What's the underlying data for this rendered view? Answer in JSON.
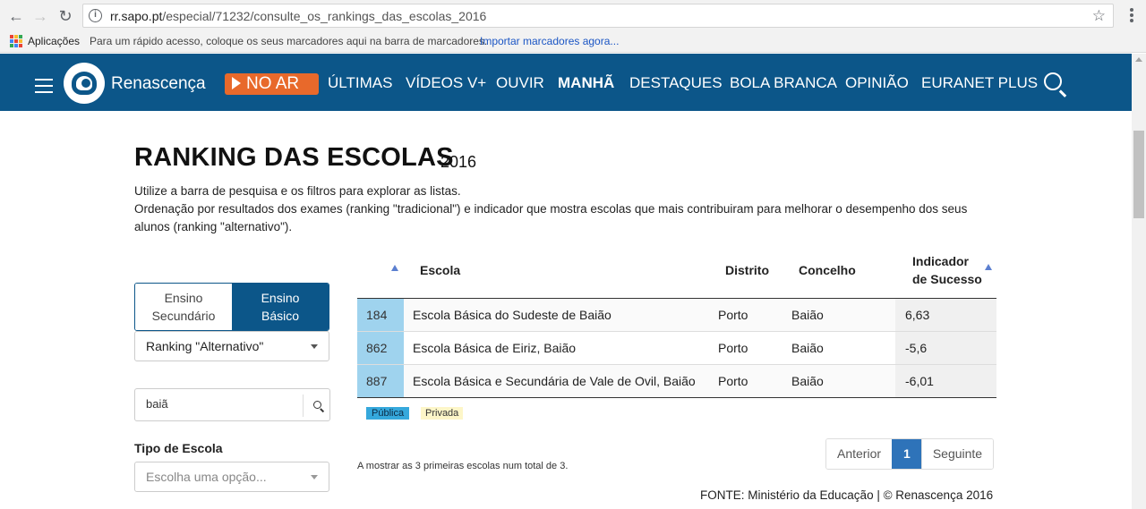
{
  "browser": {
    "url_host": "rr.sapo.pt",
    "url_path": "/especial/71232/consulte_os_rankings_das_escolas_2016",
    "bookmarks": {
      "apps_label": "Aplicações",
      "hint": "Para um rápido acesso, coloque os seus marcadores aqui na barra de marcadores.",
      "import_link": "Importar marcadores agora..."
    }
  },
  "header": {
    "brand": "Renascença",
    "live_label": "NO AR",
    "nav": [
      "ÚLTIMAS",
      "VÍDEOS V+",
      "OUVIR",
      "MANHÃ",
      "DESTAQUES",
      "BOLA BRANCA",
      "OPINIÃO",
      "EURANET PLUS"
    ],
    "active_nav": "MANHÃ",
    "colors": {
      "bar": "#0c5689",
      "live": "#e8692b"
    }
  },
  "page": {
    "title": "RANKING DAS ESCOLAS",
    "year": "2016",
    "intro_line1": "Utilize a barra de pesquisa e os filtros para explorar as listas.",
    "intro_line2": "Ordenação por resultados dos exames (ranking \"tradicional\") e indicador que mostra escolas que mais contribuiram para melhorar o desempenho dos seus alunos (ranking \"alternativo\")."
  },
  "filters": {
    "level_tabs": [
      {
        "line1": "Ensino",
        "line2": "Secundário",
        "selected": false
      },
      {
        "line1": "Ensino",
        "line2": "Básico",
        "selected": true
      }
    ],
    "ranking_select": "Ranking \"Alternativo\"",
    "search_value": "baiã",
    "school_type_label": "Tipo de Escola",
    "school_type_placeholder": "Escolha uma opção..."
  },
  "table": {
    "columns": {
      "escola": "Escola",
      "distrito": "Distrito",
      "concelho": "Concelho",
      "indicador_line1": "Indicador",
      "indicador_line2": "de Sucesso"
    },
    "rows": [
      {
        "rank": "184",
        "escola": "Escola Básica do Sudeste de Baião",
        "distrito": "Porto",
        "concelho": "Baião",
        "indicador": "6,63"
      },
      {
        "rank": "862",
        "escola": "Escola Básica de Eiriz, Baião",
        "distrito": "Porto",
        "concelho": "Baião",
        "indicador": "-5,6"
      },
      {
        "rank": "887",
        "escola": "Escola Básica e Secundária de Vale de Ovil, Baião",
        "distrito": "Porto",
        "concelho": "Baião",
        "indicador": "-6,01"
      }
    ],
    "legend": {
      "publica": "Pública",
      "privada": "Privada"
    },
    "count_text": "A mostrar as 3 primeiras escolas num total de 3.",
    "pagination": {
      "prev": "Anterior",
      "current": "1",
      "next": "Seguinte"
    }
  },
  "footer": {
    "source": "FONTE: Ministério da Educação | © Renascença 2016"
  }
}
